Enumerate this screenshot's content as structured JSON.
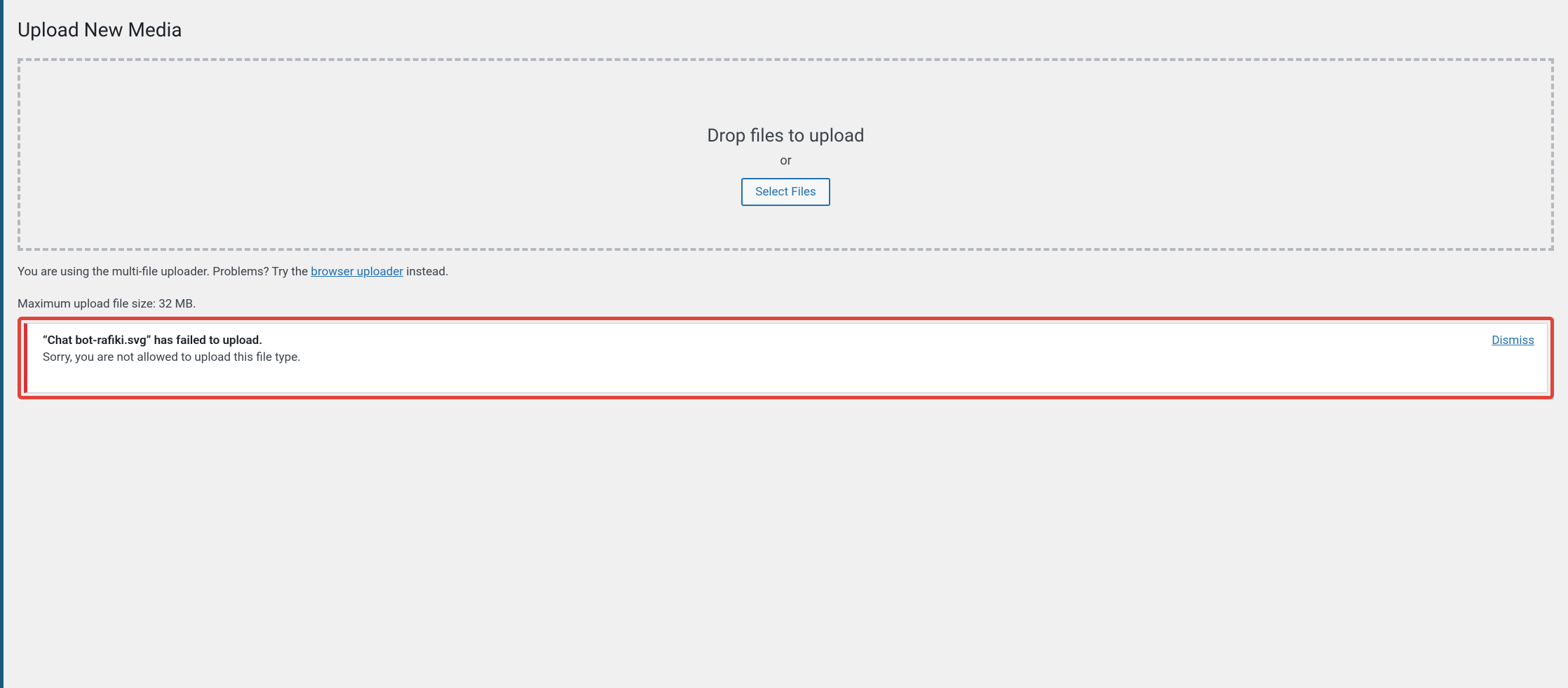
{
  "page": {
    "title": "Upload New Media"
  },
  "dropzone": {
    "heading": "Drop files to upload",
    "or_text": "or",
    "select_button": "Select Files"
  },
  "info": {
    "prefix": "You are using the multi-file uploader. Problems? Try the ",
    "link_text": "browser uploader",
    "suffix": " instead."
  },
  "max_upload": "Maximum upload file size: 32 MB.",
  "error": {
    "title": "“Chat bot-rafiki.svg” has failed to upload.",
    "detail": "Sorry, you are not allowed to upload this file type.",
    "dismiss": "Dismiss"
  }
}
